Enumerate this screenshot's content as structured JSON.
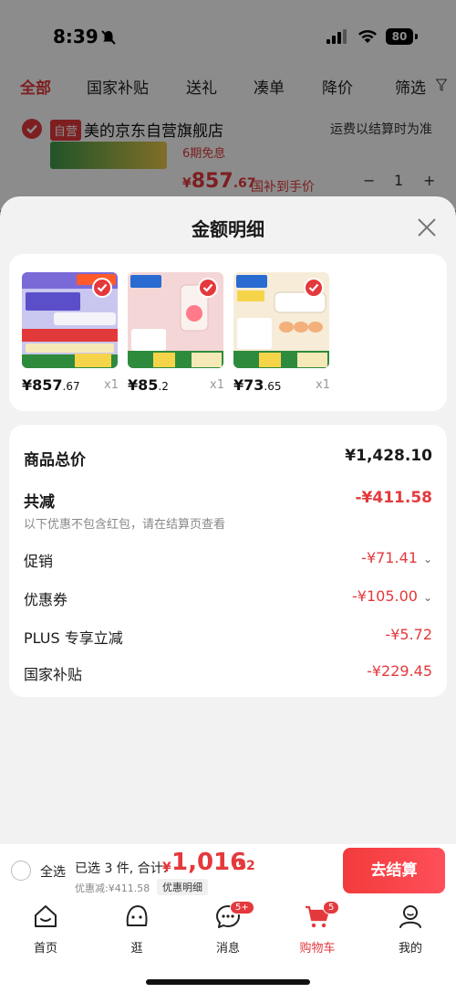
{
  "status": {
    "time": "8:39",
    "battery": "80"
  },
  "filters": [
    "全部",
    "国家补贴",
    "送礼",
    "凑单",
    "降价",
    "筛选"
  ],
  "store": {
    "badge": "自营",
    "name": "美的京东自营旗舰店",
    "shipping": "运费以结算时为准",
    "installment": "6期免息",
    "price_symbol": "¥",
    "price_int": "857",
    "price_dec": ".67",
    "price_label": "国补到手价",
    "qty": "1",
    "minus": "−",
    "plus": "+"
  },
  "sheet": {
    "title": "金额明细",
    "products": [
      {
        "price_int": "¥857",
        "price_dec": ".67",
        "qty": "x1"
      },
      {
        "price_int": "¥85",
        "price_dec": ".2",
        "qty": "x1"
      },
      {
        "price_int": "¥73",
        "price_dec": ".65",
        "qty": "x1"
      }
    ],
    "summary": {
      "total_label": "商品总价",
      "total_value": "¥1,428.10",
      "reduce_label": "共减",
      "reduce_value": "-¥411.58",
      "reduce_note": "以下优惠不包含红包，请在结算页查看",
      "promo_label": "促销",
      "promo_value": "-¥71.41",
      "coupon_label": "优惠券",
      "coupon_value": "-¥105.00",
      "plus_label": "PLUS 专享立减",
      "plus_value": "-¥5.72",
      "subsidy_label": "国家补贴",
      "subsidy_value": "-¥229.45"
    }
  },
  "checkout": {
    "select_all": "全选",
    "selected_text": "已选 3 件, 合计:",
    "currency": "¥",
    "total_int": "1,016",
    "total_dec": ".52",
    "discount_text": "优惠减:¥411.58",
    "detail_chip": "优惠明细",
    "button": "去结算"
  },
  "nav": [
    {
      "label": "首页",
      "badge": ""
    },
    {
      "label": "逛",
      "badge": ""
    },
    {
      "label": "消息",
      "badge": "5+"
    },
    {
      "label": "购物车",
      "badge": "5"
    },
    {
      "label": "我的",
      "badge": ""
    }
  ],
  "colors": {
    "accent": "#e4393c",
    "sheet_bg": "#f2f2f2"
  }
}
